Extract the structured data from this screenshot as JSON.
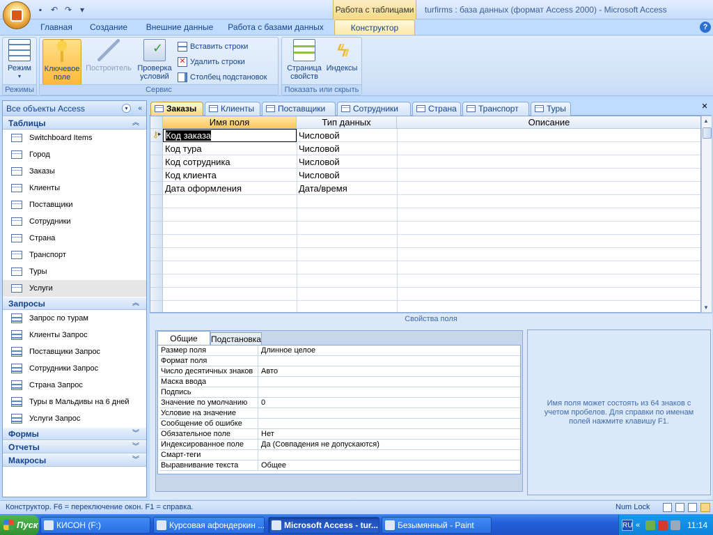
{
  "window": {
    "title": "turfirms : база данных (формат Access 2000) - Microsoft Access",
    "context_tab_title": "Работа с таблицами"
  },
  "ribbon_tabs": [
    "Главная",
    "Создание",
    "Внешние данные",
    "Работа с базами данных",
    "Конструктор"
  ],
  "ribbon": {
    "groups": {
      "modes": {
        "label": "Режимы",
        "btn_mode": "Режим"
      },
      "service": {
        "label": "Сервис",
        "btn_key_1": "Ключевое",
        "btn_key_2": "поле",
        "btn_builder": "Построитель",
        "btn_check_1": "Проверка",
        "btn_check_2": "условий",
        "btn_insert_rows": "Вставить строки",
        "btn_delete_rows": "Удалить строки",
        "btn_lookup_col": "Столбец  подстановок"
      },
      "show_hide": {
        "label": "Показать или скрыть",
        "btn_props_1": "Страница",
        "btn_props_2": "свойств",
        "btn_indexes": "Индексы"
      }
    }
  },
  "nav": {
    "header": "Все объекты Access",
    "sections": {
      "tables": "Таблицы",
      "queries": "Запросы",
      "forms": "Формы",
      "reports": "Отчеты",
      "macros": "Макросы"
    },
    "tables": [
      "Switchboard Items",
      "Город",
      "Заказы",
      "Клиенты",
      "Поставщики",
      "Сотрудники",
      "Страна",
      "Транспорт",
      "Туры",
      "Услуги"
    ],
    "queries": [
      "Запрос по турам",
      "Клиенты Запрос",
      "Поставщики Запрос",
      "Сотрудники Запрос",
      "Страна Запрос",
      "Туры в Мальдивы на 6 дней",
      "Услуги Запрос"
    ]
  },
  "doc_tabs": [
    "Заказы",
    "Клиенты",
    "Поставщики",
    "Сотрудники",
    "Страна",
    "Транспорт",
    "Туры"
  ],
  "grid": {
    "headers": {
      "field": "Имя поля",
      "type": "Тип данных",
      "desc": "Описание"
    },
    "rows": [
      {
        "field": "Код заказа",
        "type": "Числовой"
      },
      {
        "field": "Код тура",
        "type": "Числовой"
      },
      {
        "field": "Код сотрудника",
        "type": "Числовой"
      },
      {
        "field": "Код клиента",
        "type": "Числовой"
      },
      {
        "field": "Дата оформления",
        "type": "Дата/время"
      }
    ]
  },
  "props": {
    "title": "Свойства поля",
    "tab_general": "Общие",
    "tab_lookup": "Подстановка",
    "rows": [
      {
        "name": "Размер поля",
        "value": "Длинное целое"
      },
      {
        "name": "Формат поля",
        "value": ""
      },
      {
        "name": "Число десятичных знаков",
        "value": "Авто"
      },
      {
        "name": "Маска ввода",
        "value": ""
      },
      {
        "name": "Подпись",
        "value": ""
      },
      {
        "name": "Значение по умолчанию",
        "value": "0"
      },
      {
        "name": "Условие на значение",
        "value": ""
      },
      {
        "name": "Сообщение об ошибке",
        "value": ""
      },
      {
        "name": "Обязательное поле",
        "value": "Нет"
      },
      {
        "name": "Индексированное поле",
        "value": "Да (Совпадения не допускаются)"
      },
      {
        "name": "Смарт-теги",
        "value": ""
      },
      {
        "name": "Выравнивание текста",
        "value": "Общее"
      }
    ],
    "help": "Имя поля может состоять из 64 знаков с учетом пробелов.  Для справки по именам полей нажмите клавишу F1."
  },
  "status": {
    "text": "Конструктор.  F6 = переключение окон.  F1 = справка.",
    "numlock": "Num Lock"
  },
  "taskbar": {
    "start": "Пуск",
    "tasks": [
      "КИСОН (F:)",
      "Курсовая афондеркин ...",
      "Microsoft Access - tur...",
      "Безымянный - Paint"
    ],
    "lang": "RU",
    "clock": "11:14"
  }
}
